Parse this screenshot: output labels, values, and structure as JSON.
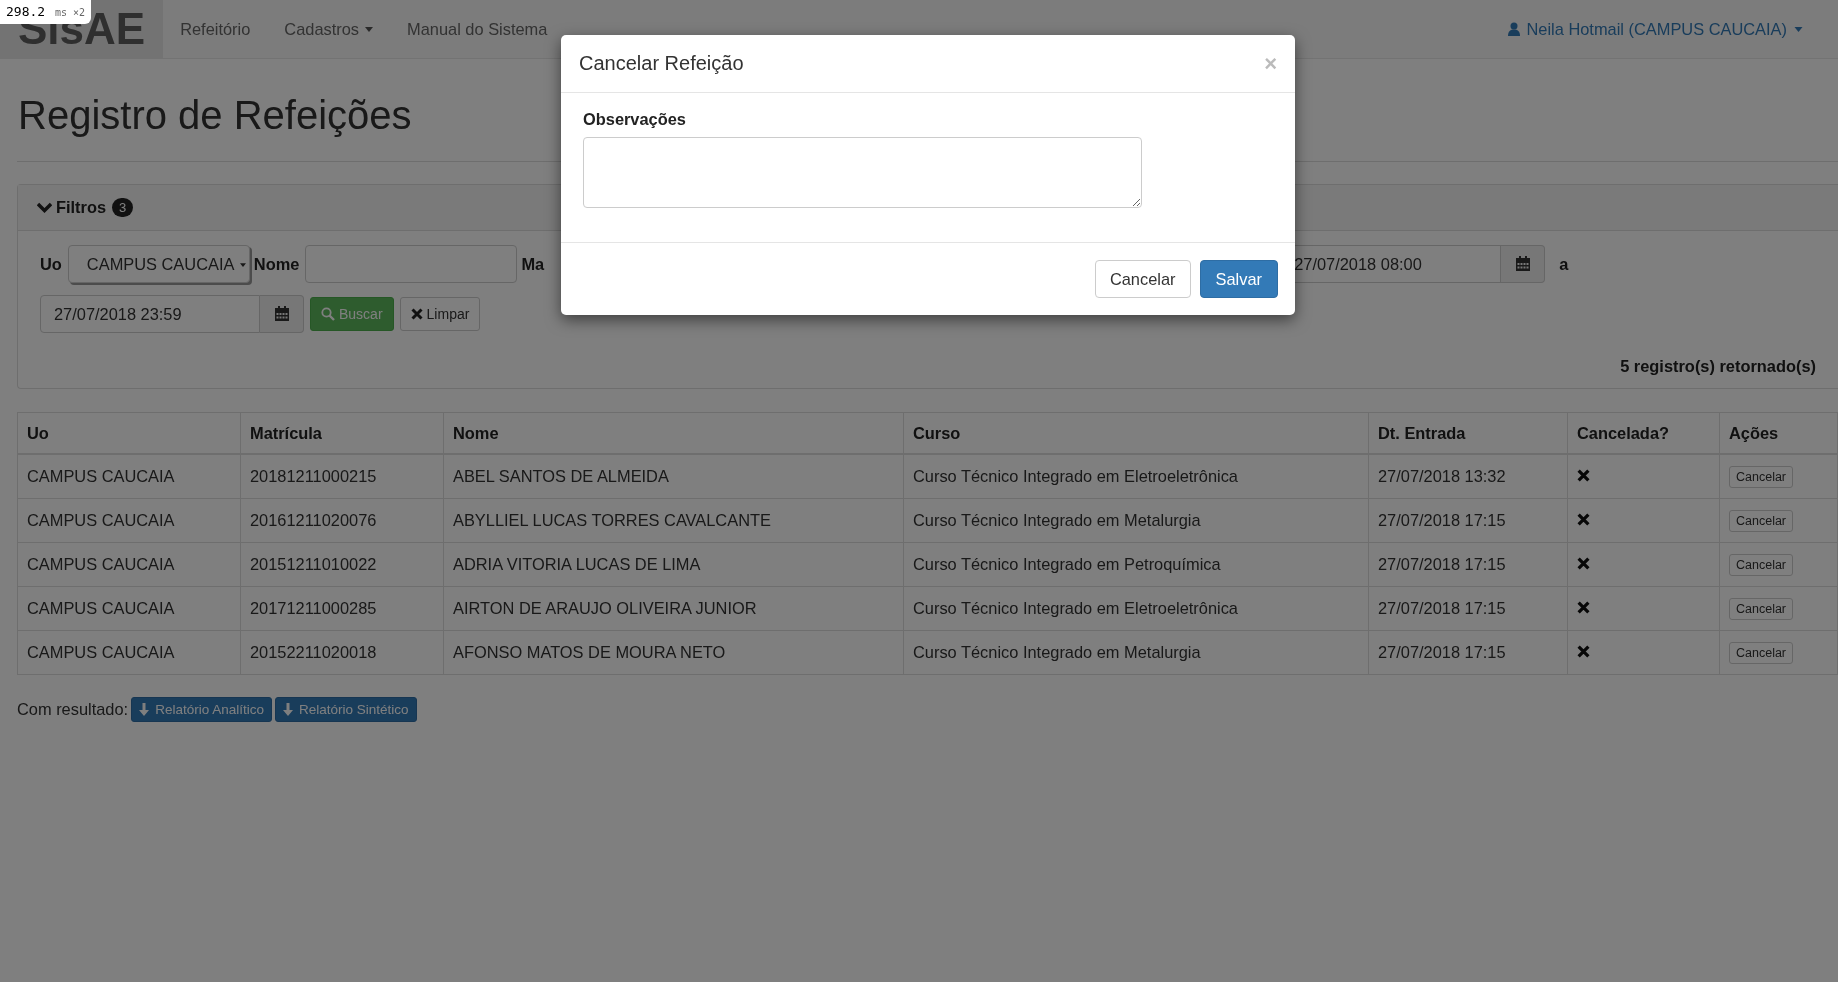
{
  "perf_badge": {
    "value": "298.2",
    "unit": "ms ×2"
  },
  "navbar": {
    "brand": "SisAE",
    "items": [
      {
        "label": "Refeitório",
        "dropdown": false
      },
      {
        "label": "Cadastros",
        "dropdown": true
      },
      {
        "label": "Manual do Sistema",
        "dropdown": false
      }
    ],
    "user": "Neila Hotmail (CAMPUS CAUCAIA)"
  },
  "page_title": "Registro de Refeições",
  "filters": {
    "title": "Filtros",
    "count": "3",
    "expanded": true,
    "uo_label": "Uo",
    "uo_value": "CAMPUS CAUCAIA",
    "nome_label": "Nome",
    "cut_label": "Ma",
    "start_date": "27/07/2018 08:00",
    "range_sep": "a",
    "end_date": "27/07/2018 23:59",
    "search_button": "Buscar",
    "clear_button": "Limpar",
    "result_count": "5 registro(s) retornado(s)"
  },
  "table": {
    "columns": [
      "Uo",
      "Matrícula",
      "Nome",
      "Curso",
      "Dt. Entrada",
      "Cancelada?",
      "Ações"
    ],
    "rows": [
      {
        "uo": "CAMPUS CAUCAIA",
        "matricula": "20181211000215",
        "nome": "ABEL SANTOS DE ALMEIDA",
        "curso": "Curso Técnico Integrado em Eletroeletrônica",
        "entrada": "27/07/2018 13:32",
        "cancelada": false,
        "action": "Cancelar"
      },
      {
        "uo": "CAMPUS CAUCAIA",
        "matricula": "20161211020076",
        "nome": "ABYLLIEL LUCAS TORRES CAVALCANTE",
        "curso": "Curso Técnico Integrado em Metalurgia",
        "entrada": "27/07/2018 17:15",
        "cancelada": false,
        "action": "Cancelar"
      },
      {
        "uo": "CAMPUS CAUCAIA",
        "matricula": "20151211010022",
        "nome": "ADRIA VITORIA LUCAS DE LIMA",
        "curso": "Curso Técnico Integrado em Petroquímica",
        "entrada": "27/07/2018 17:15",
        "cancelada": false,
        "action": "Cancelar"
      },
      {
        "uo": "CAMPUS CAUCAIA",
        "matricula": "20171211000285",
        "nome": "AIRTON DE ARAUJO OLIVEIRA JUNIOR",
        "curso": "Curso Técnico Integrado em Eletroeletrônica",
        "entrada": "27/07/2018 17:15",
        "cancelada": false,
        "action": "Cancelar"
      },
      {
        "uo": "CAMPUS CAUCAIA",
        "matricula": "20152211020018",
        "nome": "AFONSO MATOS DE MOURA NETO",
        "curso": "Curso Técnico Integrado em Metalurgia",
        "entrada": "27/07/2018 17:15",
        "cancelada": false,
        "action": "Cancelar"
      }
    ]
  },
  "reports": {
    "label": "Com resultado:",
    "buttons": [
      "Relatório Analítico",
      "Relatório Sintético"
    ]
  },
  "modal": {
    "title": "Cancelar Refeição",
    "close": "×",
    "field_label": "Observações",
    "buttons": [
      {
        "label": "Cancelar",
        "kind": "default"
      },
      {
        "label": "Salvar",
        "kind": "primary"
      }
    ]
  }
}
